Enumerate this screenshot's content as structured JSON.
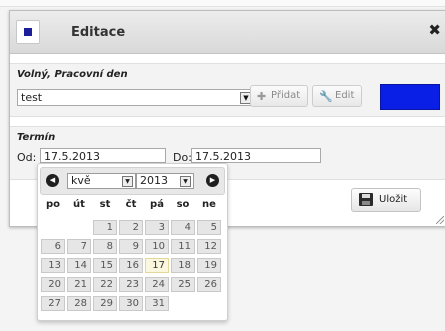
{
  "dialog": {
    "title": "Editace",
    "close_icon": "close-x-icon",
    "section1_label": "Volný, Pracovní den",
    "select_value": "test",
    "add_label": "Přidat",
    "edit_label": "Edit",
    "blue_button_color": "#0a1fe6",
    "section2_label": "Termín",
    "od_label": "Od:",
    "od_value": "17.5.2013",
    "do_label": "Do:",
    "do_value": "17.5.2013",
    "save_label": "Uložit"
  },
  "datepicker": {
    "month": "kvě",
    "year": "2013",
    "weekdays": [
      "po",
      "út",
      "st",
      "čt",
      "pá",
      "so",
      "ne"
    ],
    "weeks": [
      [
        "",
        "",
        "1",
        "2",
        "3",
        "4",
        "5"
      ],
      [
        "6",
        "7",
        "8",
        "9",
        "10",
        "11",
        "12"
      ],
      [
        "13",
        "14",
        "15",
        "16",
        "17",
        "18",
        "19"
      ],
      [
        "20",
        "21",
        "22",
        "23",
        "24",
        "25",
        "26"
      ],
      [
        "27",
        "28",
        "29",
        "30",
        "31",
        "",
        ""
      ]
    ],
    "today": "17",
    "today_color": "#fbf7df"
  }
}
